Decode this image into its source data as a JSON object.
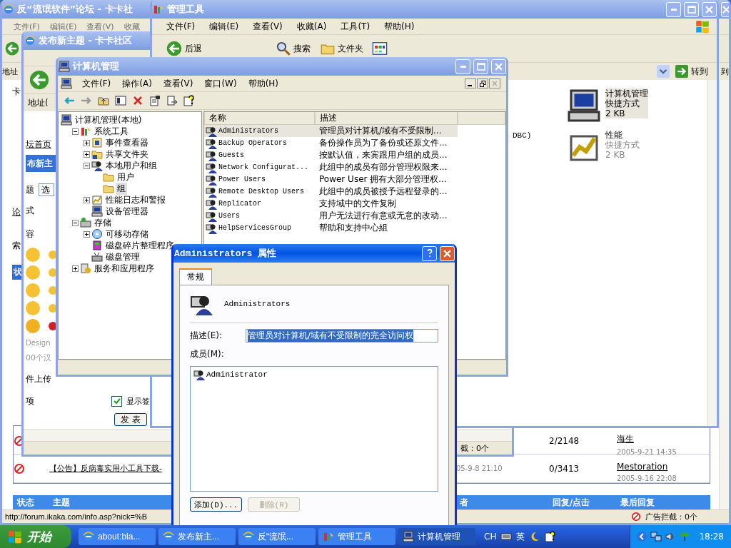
{
  "forum_window": {
    "title": "反“流氓软件”论坛 - 卡卡社",
    "active": false,
    "menu": [
      "文件(F)",
      "编辑(E)",
      "查看(V)",
      "收藏"
    ],
    "address_label": "地址",
    "go_fragment": "到",
    "side_fragments": [
      "卡",
      "论",
      "索",
      "状"
    ],
    "rows": [
      {
        "replies": "2/2148",
        "last_user": "海生",
        "last_time": "2005-9-21 14:35"
      },
      {
        "title": "【公告】反病毒实用小工具下载-",
        "time": "05-9-8 21:10",
        "replies": "0/3413",
        "last_user": "Mestoration",
        "last_time": "2005-9-16 22:08"
      }
    ],
    "header": [
      "状态",
      "主题",
      "者",
      "回复/点击",
      "最后回复"
    ],
    "status_url": "http://forum.ikaka.com/info.asp?nick=%B",
    "status_block": "广告拦截：0个"
  },
  "post_window": {
    "title": "发布新主题 - 卡卡社区",
    "active": false,
    "address_label": "地址(",
    "home_link": "坛首页",
    "banner": "布新主",
    "subject_label": "题",
    "subject_select": "选",
    "format_label": "式",
    "content_label": "容",
    "design_note": "Design",
    "limit_note": "00个汉",
    "upload_label": "件上传",
    "options_label": "项",
    "signature": {
      "label": "显示签",
      "checked": true
    },
    "submit": "发 表",
    "status_block": "截：0个"
  },
  "admin_window": {
    "title": "管理工具",
    "active": false,
    "menu": [
      "文件(F)",
      "编辑(E)",
      "查看(V)",
      "收藏(A)",
      "工具(T)",
      "帮助(H)"
    ],
    "toolbar": [
      "后退",
      "搜索",
      "文件夹"
    ],
    "go": "转到",
    "fragment": "DBC)",
    "items": [
      {
        "name": "计算机管理",
        "type": "快捷方式",
        "size": "2 KB",
        "selected": true
      },
      {
        "name": "性能",
        "type": "快捷方式",
        "size": "2 KB",
        "selected": false
      }
    ]
  },
  "comp_window": {
    "title": "计算机管理",
    "active": false,
    "menu": [
      "文件(F)",
      "操作(A)",
      "查看(V)",
      "窗口(W)",
      "帮助(H)"
    ],
    "tree": [
      {
        "label": "计算机管理(本地)",
        "selected": false,
        "children": [
          {
            "label": "系统工具",
            "kind": "branch",
            "expanded": true,
            "selected": false,
            "children": [
              {
                "label": "事件查看器",
                "kind": "branch",
                "expanded": false,
                "selected": false
              },
              {
                "label": "共享文件夹",
                "kind": "branch",
                "expanded": false,
                "selected": false
              },
              {
                "label": "本地用户和组",
                "kind": "branch",
                "expanded": true,
                "selected": false,
                "children": [
                  {
                    "label": "用户",
                    "kind": "leaf",
                    "selected": false
                  },
                  {
                    "label": "组",
                    "kind": "leaf",
                    "selected": true
                  }
                ]
              },
              {
                "label": "性能日志和警报",
                "kind": "branch",
                "expanded": false,
                "selected": false
              },
              {
                "label": "设备管理器",
                "kind": "leaf",
                "selected": false
              }
            ]
          },
          {
            "label": "存储",
            "kind": "branch",
            "expanded": true,
            "selected": false,
            "children": [
              {
                "label": "可移动存储",
                "kind": "branch",
                "expanded": false,
                "selected": false
              },
              {
                "label": "磁盘碎片整理程序",
                "kind": "leaf",
                "selected": false
              },
              {
                "label": "磁盘管理",
                "kind": "leaf",
                "selected": false
              }
            ]
          },
          {
            "label": "服务和应用程序",
            "kind": "branch",
            "expanded": false,
            "selected": false
          }
        ]
      }
    ],
    "columns": [
      "名称",
      "描述"
    ],
    "rows": [
      {
        "name": "Administrators",
        "description": "管理员对计算机/域有不受限制...",
        "selected": true
      },
      {
        "name": "Backup Operators",
        "description": "备份操作员为了备份或还原文件...",
        "selected": false
      },
      {
        "name": "Guests",
        "description": "按默认值，来宾跟用户组的成员...",
        "selected": false
      },
      {
        "name": "Network Configurat...",
        "description": "此组中的成员有部分管理权限来...",
        "selected": false
      },
      {
        "name": "Power Users",
        "description": "Power User 拥有大部分管理权...",
        "selected": false
      },
      {
        "name": "Remote Desktop Users",
        "description": "此组中的成员被授予远程登录的...",
        "selected": false
      },
      {
        "name": "Replicator",
        "description": "支持域中的文件复制",
        "selected": false
      },
      {
        "name": "Users",
        "description": "用户无法进行有意或无意的改动...",
        "selected": false
      },
      {
        "name": "HelpServicesGroup",
        "description": "帮助和支持中心組",
        "selected": false
      }
    ]
  },
  "dialog": {
    "title": "Administrators 属性",
    "active": true,
    "tabs": [
      {
        "label": "常规",
        "selected": true
      }
    ],
    "group_name": "Administrators",
    "description_label": "描述(E):",
    "description": "管理员对计算机/域有不受限制的完全访问权",
    "members_label": "成员(M):",
    "members": [
      "Administrator"
    ],
    "buttons": [
      {
        "label": "添加(D)...",
        "disabled": false
      },
      {
        "label": "删除(R)",
        "disabled": true
      }
    ]
  },
  "taskbar": {
    "start": "开始",
    "tasks": [
      {
        "label": "about:bla...",
        "selected": false
      },
      {
        "label": "发布新主...",
        "selected": false
      },
      {
        "label": "反“流氓...",
        "selected": false
      },
      {
        "label": "管理工具",
        "selected": false
      },
      {
        "label": "计算机管理",
        "selected": true
      }
    ],
    "language": "CH",
    "ime": "英",
    "clock": "18:28"
  }
}
